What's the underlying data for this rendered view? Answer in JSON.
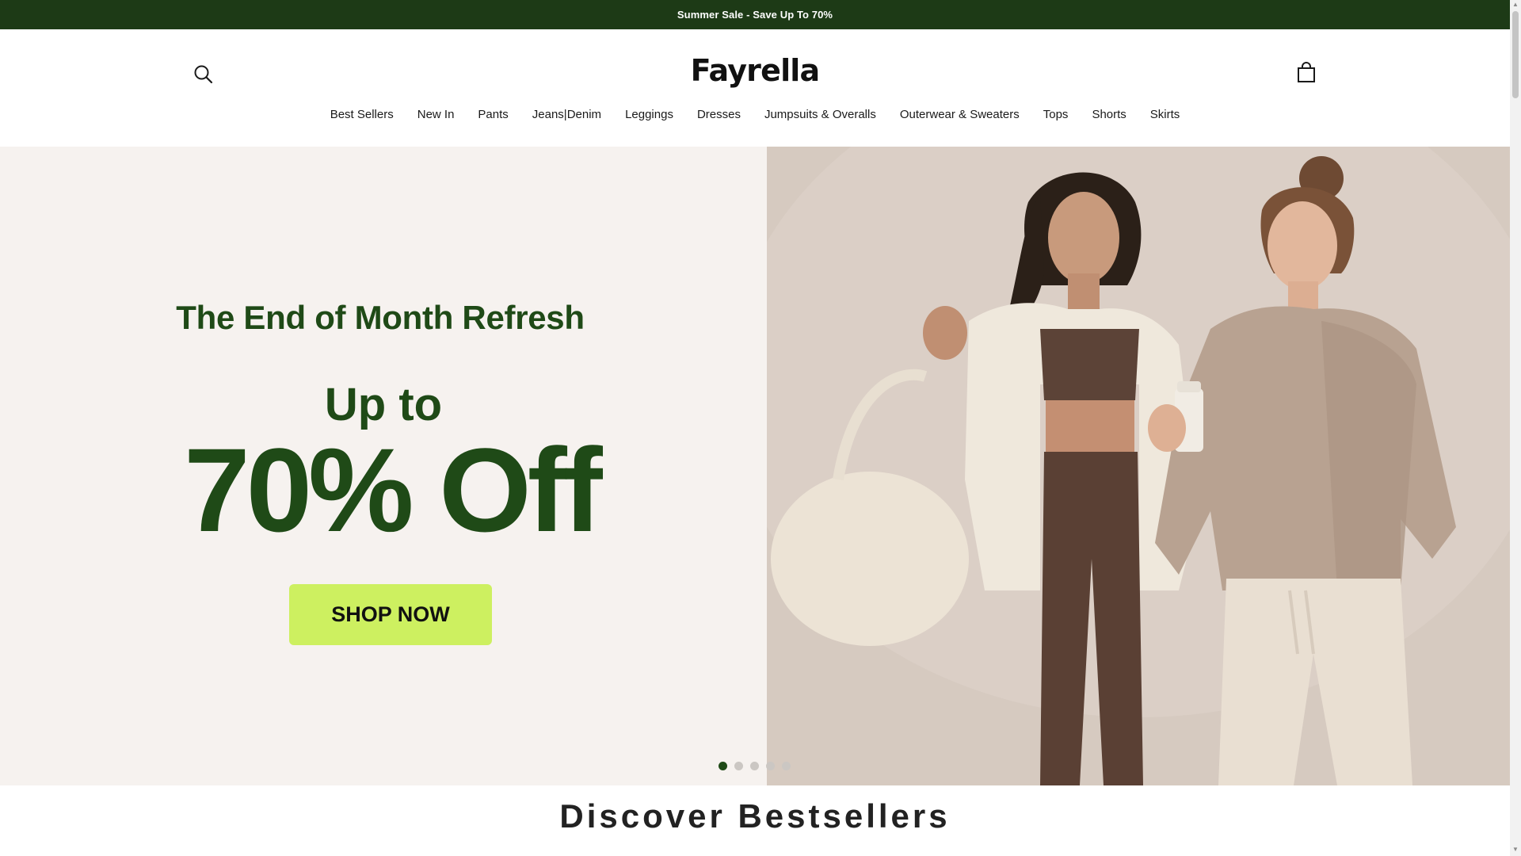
{
  "announcement": {
    "text": "Summer Sale - Save Up To 70%"
  },
  "header": {
    "logo": "Fayrella",
    "search_icon": "search-icon",
    "cart_icon": "shopping-bag-icon"
  },
  "nav": {
    "items": [
      "Best Sellers",
      "New In",
      "Pants",
      "Jeans|Denim",
      "Leggings",
      "Dresses",
      "Jumpsuits & Overalls",
      "Outerwear & Sweaters",
      "Tops",
      "Shorts",
      "Skirts"
    ]
  },
  "hero": {
    "headline": "The End of Month Refresh",
    "upto": "Up to",
    "discount": "70% Off",
    "cta": "SHOP NOW",
    "slides": {
      "count": 5,
      "active": 1
    },
    "colors": {
      "accent": "#1f4a17",
      "cta_bg": "#cdf060",
      "banner_bg": "#1d3a16"
    }
  },
  "sections": {
    "bestsellers_title": "Discover Bestsellers"
  }
}
